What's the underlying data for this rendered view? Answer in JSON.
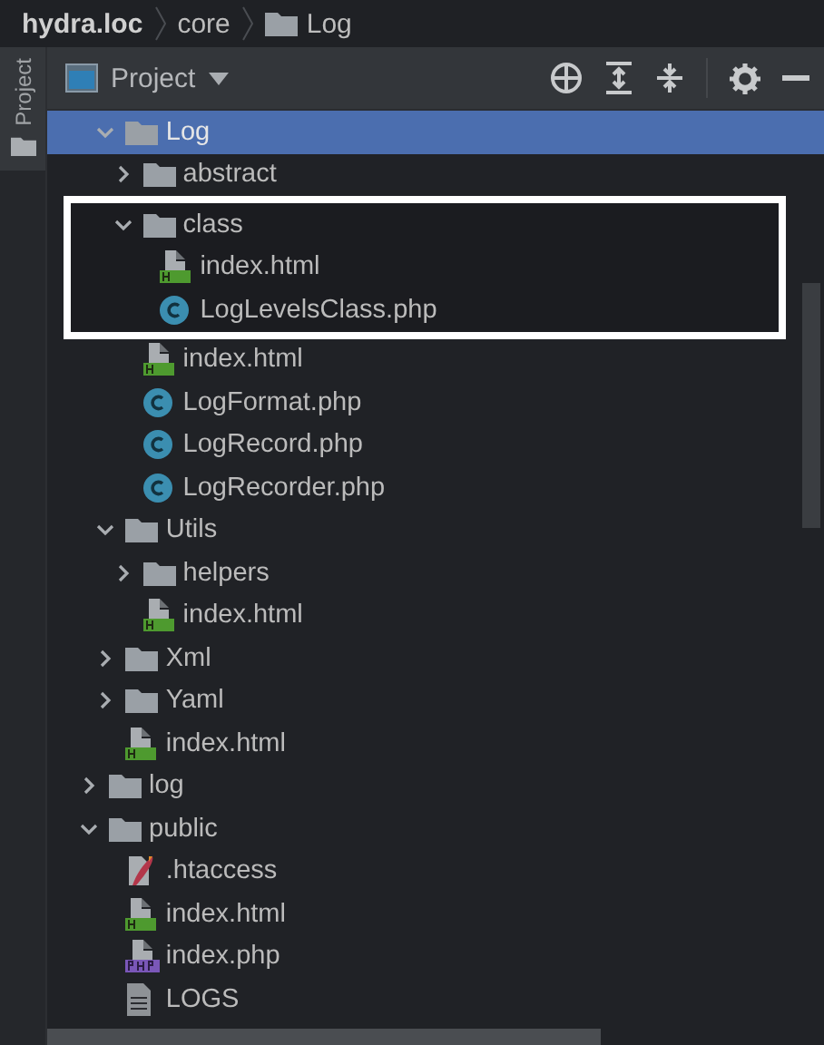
{
  "breadcrumb": [
    {
      "label": "hydra.loc",
      "kind": "project"
    },
    {
      "label": "core",
      "kind": "dir"
    },
    {
      "label": "Log",
      "kind": "folder"
    }
  ],
  "side_tab": {
    "label": "Project",
    "selected": true
  },
  "panel": {
    "title": "Project"
  },
  "tree": [
    {
      "kind": "hidden_parent",
      "children": [
        {
          "name": "Log",
          "kind": "folder",
          "expanded": true,
          "selected": true,
          "children": [
            {
              "name": "abstract",
              "kind": "folder",
              "expanded": false,
              "selected": false
            },
            {
              "name": "class",
              "kind": "folder",
              "expanded": true,
              "selected": false,
              "highlighted": true,
              "children": [
                {
                  "name": "index.html",
                  "kind": "html",
                  "selected": false
                },
                {
                  "name": "LogLevelsClass.php",
                  "kind": "class",
                  "selected": false
                }
              ]
            },
            {
              "name": "index.html",
              "kind": "html",
              "selected": false
            },
            {
              "name": "LogFormat.php",
              "kind": "class",
              "selected": false
            },
            {
              "name": "LogRecord.php",
              "kind": "class",
              "selected": false
            },
            {
              "name": "LogRecorder.php",
              "kind": "class",
              "selected": false
            }
          ]
        },
        {
          "name": "Utils",
          "kind": "folder",
          "expanded": true,
          "selected": false,
          "children": [
            {
              "name": "helpers",
              "kind": "folder",
              "expanded": false,
              "selected": false
            },
            {
              "name": "index.html",
              "kind": "html",
              "selected": false
            }
          ]
        },
        {
          "name": "Xml",
          "kind": "folder",
          "expanded": false,
          "selected": false
        },
        {
          "name": "Yaml",
          "kind": "folder",
          "expanded": false,
          "selected": false
        },
        {
          "name": "index.html",
          "kind": "html",
          "selected": false
        }
      ]
    },
    {
      "name": "log",
      "kind": "folder",
      "expanded": false,
      "selected": false
    },
    {
      "name": "public",
      "kind": "folder",
      "expanded": true,
      "selected": false,
      "children": [
        {
          "name": ".htaccess",
          "kind": "htaccess",
          "selected": false
        },
        {
          "name": "index.html",
          "kind": "html",
          "selected": false
        },
        {
          "name": "index.php",
          "kind": "php",
          "selected": false
        },
        {
          "name": "LOGS",
          "kind": "text",
          "selected": false
        }
      ]
    }
  ]
}
